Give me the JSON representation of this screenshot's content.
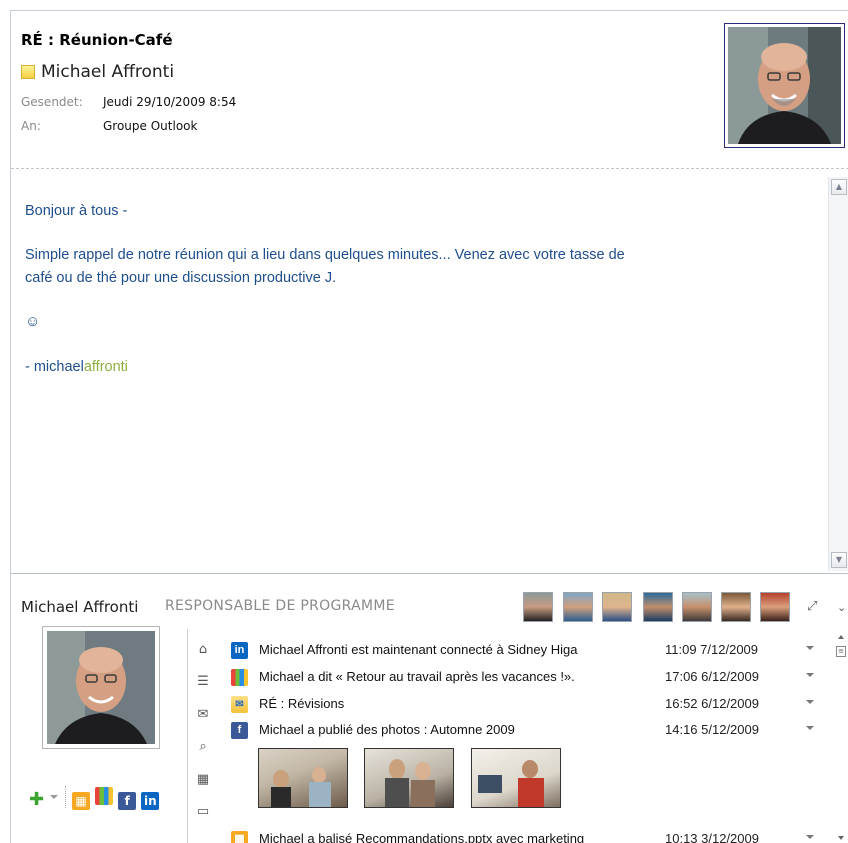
{
  "header": {
    "subject": "RÉ : Réunion-Café",
    "sender": "Michael Affronti",
    "sent_label": "Gesendet:",
    "sent_value": "Jeudi 29/10/2009 8:54",
    "to_label": "An:",
    "to_value": "Groupe Outlook"
  },
  "body": {
    "greeting": "Bonjour à tous -",
    "line1": "Simple rappel de notre réunion qui a lieu dans quelques minutes... Venez avec votre tasse de",
    "line2": "café ou de thé pour une discussion productive J.",
    "smiley": "☺",
    "sig_prefix": "- michael",
    "sig_suffix": "affronti"
  },
  "people_pane": {
    "name": "Michael Affronti",
    "title": "RESPONSABLE DE PROGRAMME",
    "feed": [
      {
        "icon": "linkedin-icon",
        "text": "Michael Affronti est maintenant connecté à Sidney Higa",
        "date": "11:09 7/12/2009"
      },
      {
        "icon": "windows-live-icon",
        "text": "Michael a dit « Retour au travail après les vacances !».",
        "date": "17:06 6/12/2009"
      },
      {
        "icon": "mail-open-icon",
        "text": "RÉ : Révisions",
        "date": "16:52 6/12/2009"
      },
      {
        "icon": "facebook-icon",
        "text": "Michael a publié des photos : Automne 2009",
        "date": "14:16 5/12/2009"
      },
      {
        "icon": "sharepoint-icon",
        "text": "Michael a balisé Recommandations.pptx avec marketing",
        "date": "10:13 3/12/2009"
      }
    ]
  },
  "colors": {
    "body_text": "#1f4e8c",
    "signature_accent": "#8dae3f",
    "linkedin": "#0a66c2",
    "facebook": "#3b5998",
    "sharepoint": "#f7a823"
  }
}
